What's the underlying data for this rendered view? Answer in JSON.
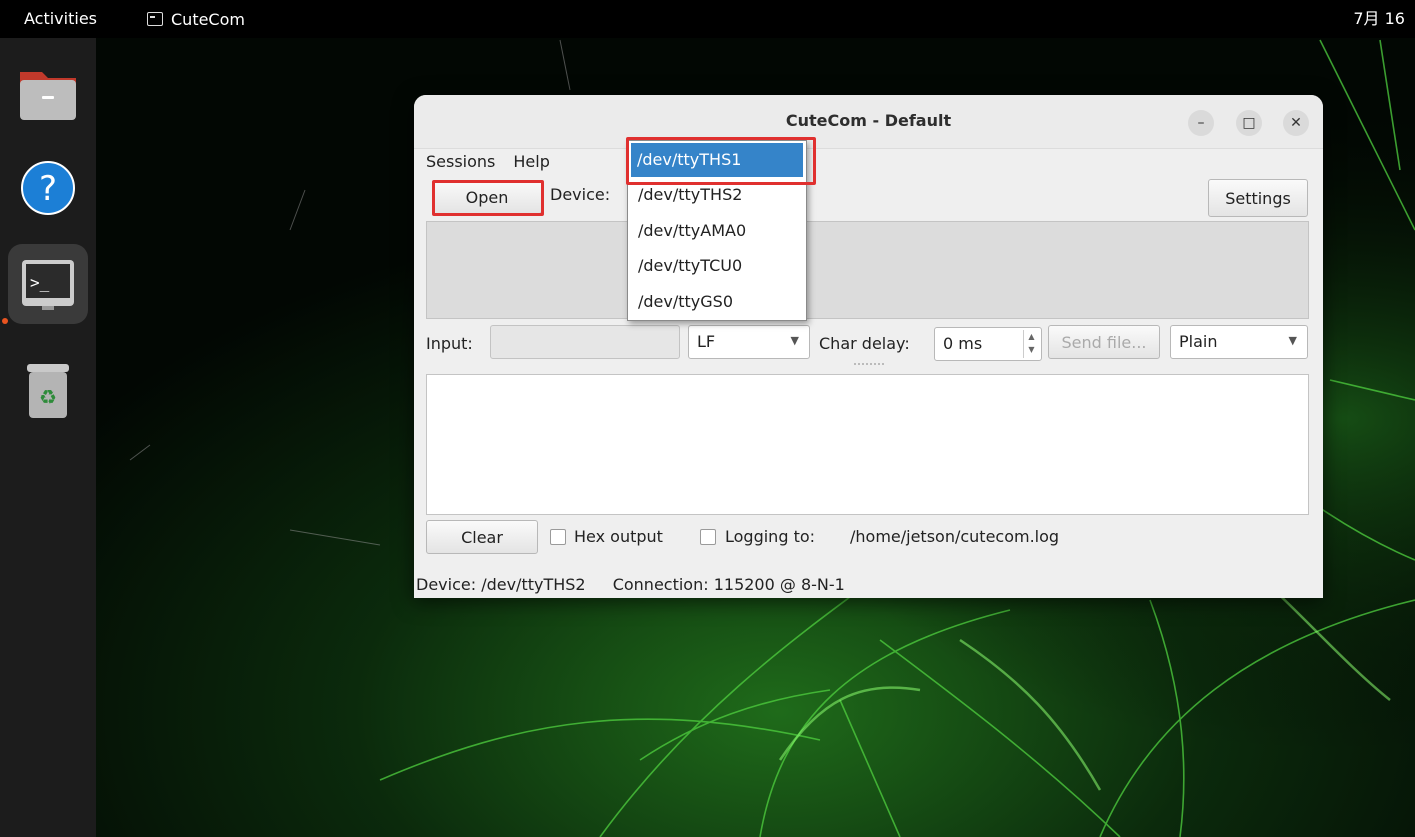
{
  "topbar": {
    "activities": "Activities",
    "app_name": "CuteCom",
    "clock": "7月 16"
  },
  "dock": {
    "items": [
      "files-icon",
      "help-icon",
      "terminal-icon",
      "trash-icon"
    ]
  },
  "window": {
    "title": "CuteCom - Default",
    "menu": {
      "sessions": "Sessions",
      "help": "Help"
    },
    "open_label": "Open",
    "device_label": "Device:",
    "settings_label": "Settings",
    "input_label": "Input:",
    "eol_value": "LF",
    "char_delay_label": "Char delay:",
    "char_delay_value": "0 ms",
    "send_file_label": "Send file...",
    "format_value": "Plain",
    "clear_label": "Clear",
    "hex_output_label": "Hex output",
    "logging_label": "Logging to:",
    "log_path": "/home/jetson/cutecom.log",
    "status_device": "Device:  /dev/ttyTHS2",
    "status_connection": "Connection:  115200 @ 8-N-1"
  },
  "device_dropdown": {
    "options": [
      "/dev/ttyTHS1",
      "/dev/ttyTHS2",
      "/dev/ttyAMA0",
      "/dev/ttyTCU0",
      "/dev/ttyGS0"
    ],
    "selected_index": 0
  },
  "colors": {
    "highlight_red": "#e0302f",
    "selection_blue": "#3584c9",
    "ubuntu_orange": "#e95420"
  }
}
